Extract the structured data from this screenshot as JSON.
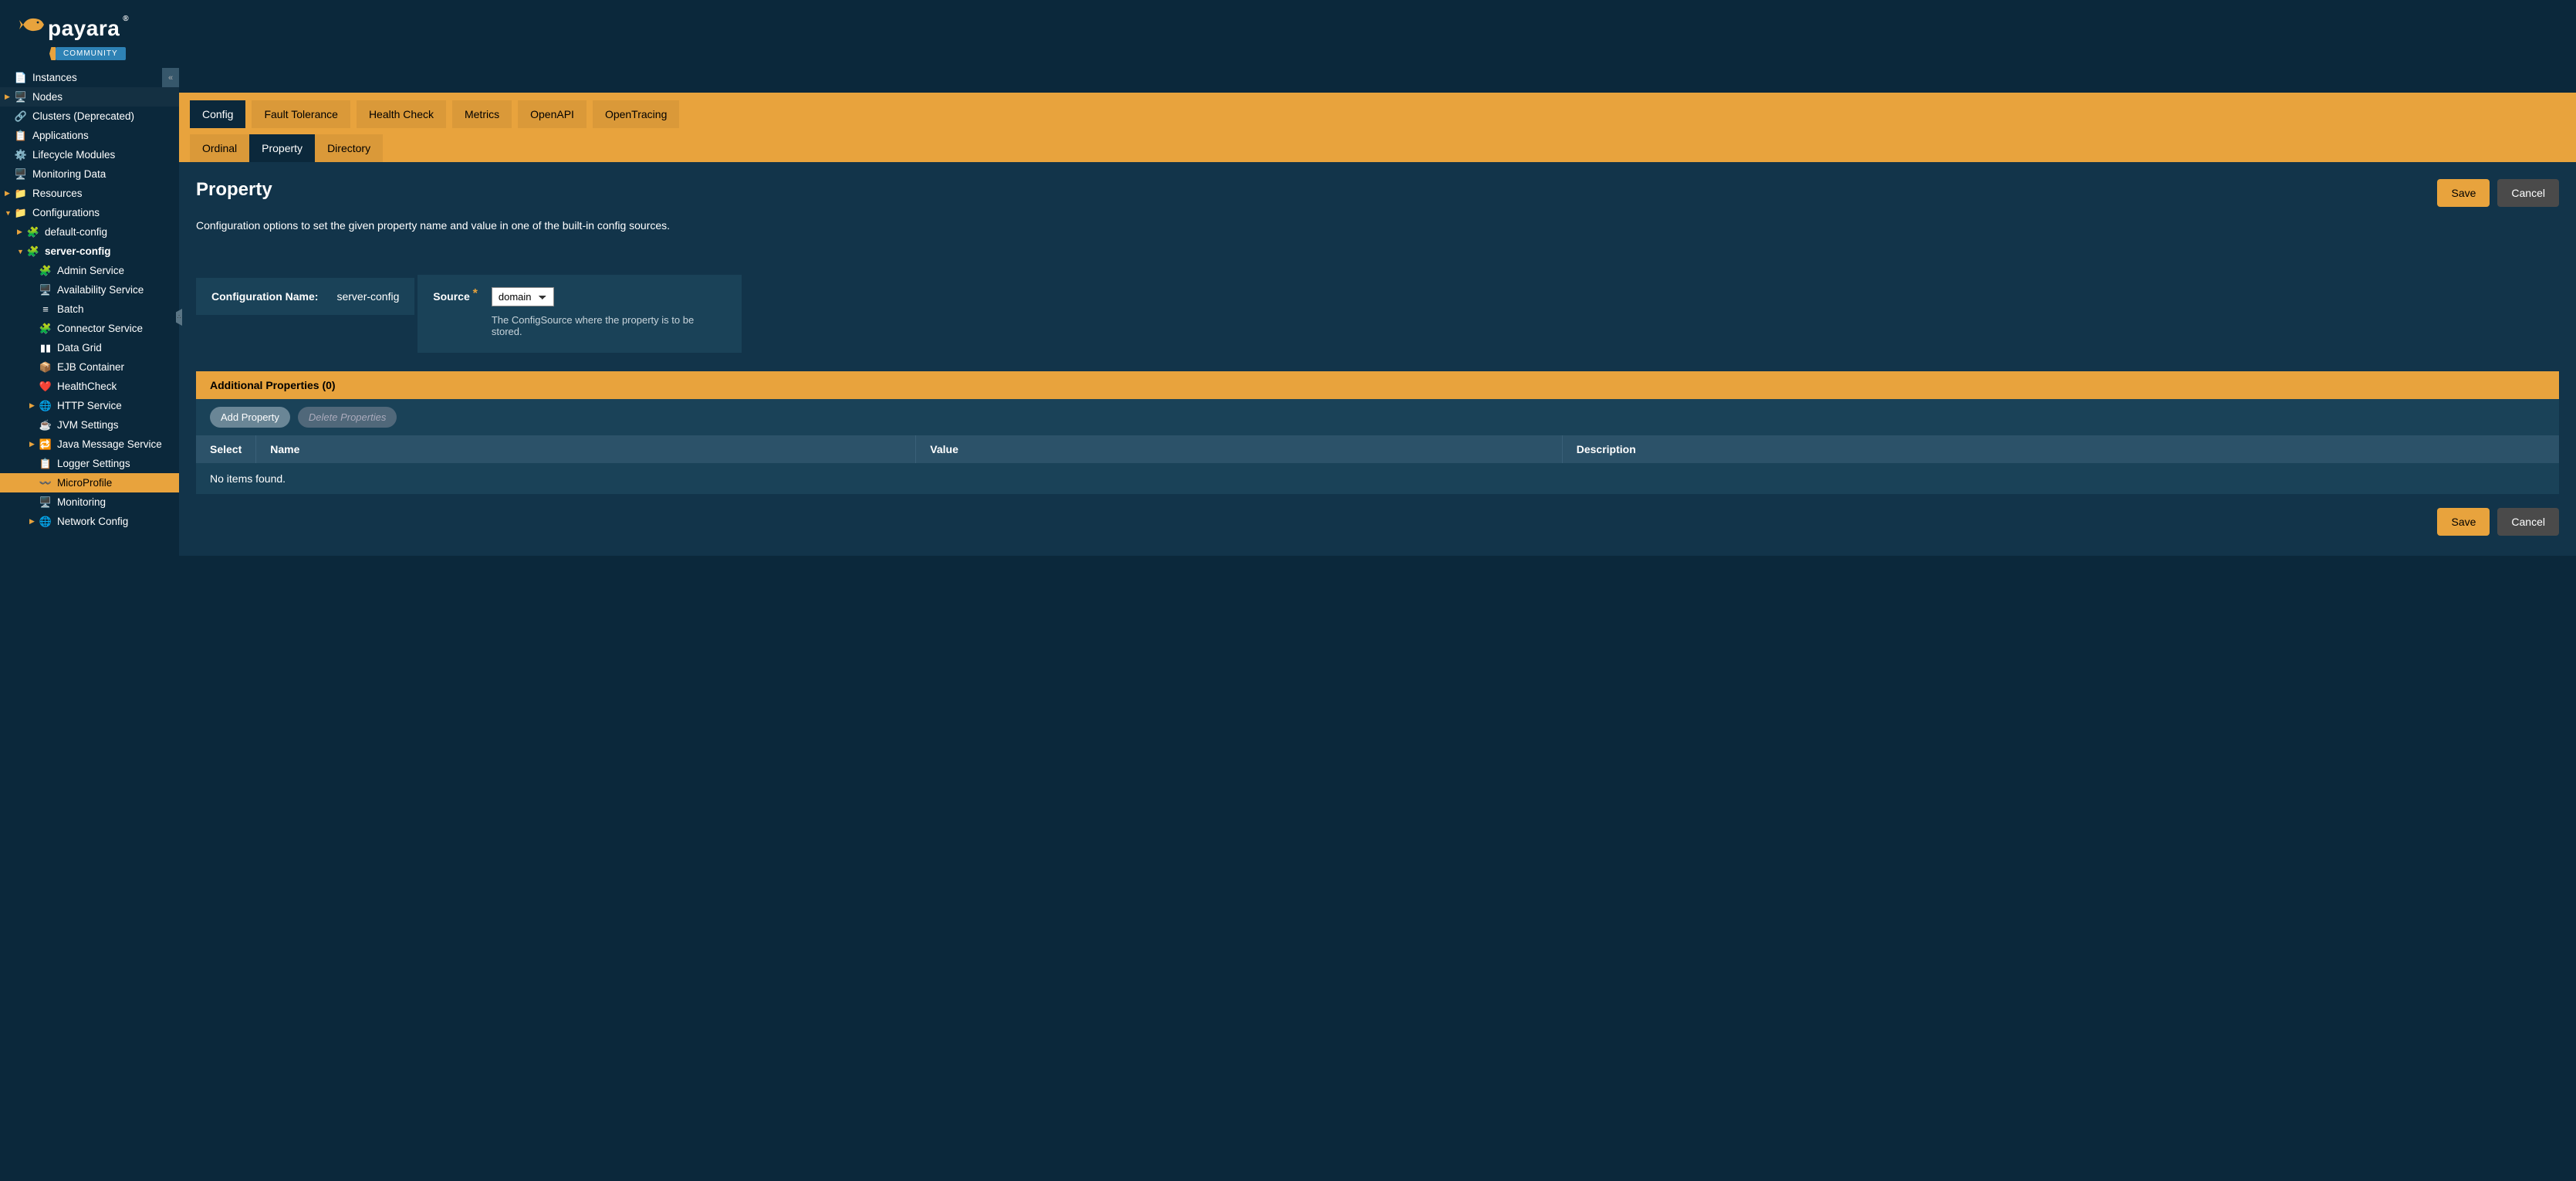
{
  "brand": {
    "name": "payara",
    "badge": "COMMUNITY",
    "registered": "®"
  },
  "sidebar": {
    "collapse_glyph": "«",
    "items": [
      {
        "label": "Instances",
        "depth": 0,
        "arrow": "none",
        "icon": "📄",
        "name": "nav-instances",
        "has_collapse_btn": true
      },
      {
        "label": "Nodes",
        "depth": 0,
        "arrow": "right",
        "icon": "🖥️",
        "name": "nav-nodes",
        "hover": true
      },
      {
        "label": "Clusters (Deprecated)",
        "depth": 0,
        "arrow": "none",
        "icon": "🔗",
        "name": "nav-clusters"
      },
      {
        "label": "Applications",
        "depth": 0,
        "arrow": "none",
        "icon": "📋",
        "name": "nav-applications"
      },
      {
        "label": "Lifecycle Modules",
        "depth": 0,
        "arrow": "none",
        "icon": "⚙️",
        "name": "nav-lifecycle"
      },
      {
        "label": "Monitoring Data",
        "depth": 0,
        "arrow": "none",
        "icon": "🖥️",
        "name": "nav-monitoring-data"
      },
      {
        "label": "Resources",
        "depth": 0,
        "arrow": "right",
        "icon": "📁",
        "name": "nav-resources"
      },
      {
        "label": "Configurations",
        "depth": 0,
        "arrow": "down",
        "icon": "📁",
        "name": "nav-configurations"
      },
      {
        "label": "default-config",
        "depth": 1,
        "arrow": "right",
        "icon": "🧩",
        "name": "nav-default-config"
      },
      {
        "label": "server-config",
        "depth": 1,
        "arrow": "down",
        "icon": "🧩",
        "name": "nav-server-config",
        "bold": true
      },
      {
        "label": "Admin Service",
        "depth": 2,
        "arrow": "none",
        "icon": "🧩",
        "name": "nav-admin-service",
        "icon_color": "#e8a33d"
      },
      {
        "label": "Availability Service",
        "depth": 2,
        "arrow": "none",
        "icon": "🖥️",
        "name": "nav-availability"
      },
      {
        "label": "Batch",
        "depth": 2,
        "arrow": "none",
        "icon": "≡",
        "name": "nav-batch"
      },
      {
        "label": "Connector Service",
        "depth": 2,
        "arrow": "none",
        "icon": "🧩",
        "name": "nav-connector",
        "icon_color": "#e8a33d"
      },
      {
        "label": "Data Grid",
        "depth": 2,
        "arrow": "none",
        "icon": "▮▮",
        "name": "nav-data-grid"
      },
      {
        "label": "EJB Container",
        "depth": 2,
        "arrow": "none",
        "icon": "📦",
        "name": "nav-ejb"
      },
      {
        "label": "HealthCheck",
        "depth": 2,
        "arrow": "none",
        "icon": "❤️",
        "name": "nav-healthcheck",
        "icon_color": "#e8a33d"
      },
      {
        "label": "HTTP Service",
        "depth": 2,
        "arrow": "right",
        "icon": "🌐",
        "name": "nav-http"
      },
      {
        "label": "JVM Settings",
        "depth": 2,
        "arrow": "none",
        "icon": "☕",
        "name": "nav-jvm"
      },
      {
        "label": "Java Message Service",
        "depth": 2,
        "arrow": "right",
        "icon": "🔁",
        "name": "nav-jms",
        "icon_color": "#e8a33d"
      },
      {
        "label": "Logger Settings",
        "depth": 2,
        "arrow": "none",
        "icon": "📋",
        "name": "nav-logger"
      },
      {
        "label": "MicroProfile",
        "depth": 2,
        "arrow": "none",
        "icon": "〰️",
        "name": "nav-microprofile",
        "sel": true
      },
      {
        "label": "Monitoring",
        "depth": 2,
        "arrow": "none",
        "icon": "🖥️",
        "name": "nav-monitoring"
      },
      {
        "label": "Network Config",
        "depth": 2,
        "arrow": "right",
        "icon": "🌐",
        "name": "nav-network"
      }
    ]
  },
  "tabs_primary": [
    {
      "label": "Config",
      "active": true,
      "name": "tab-config"
    },
    {
      "label": "Fault Tolerance",
      "active": false,
      "name": "tab-fault-tolerance"
    },
    {
      "label": "Health Check",
      "active": false,
      "name": "tab-health-check"
    },
    {
      "label": "Metrics",
      "active": false,
      "name": "tab-metrics"
    },
    {
      "label": "OpenAPI",
      "active": false,
      "name": "tab-openapi"
    },
    {
      "label": "OpenTracing",
      "active": false,
      "name": "tab-opentracing"
    }
  ],
  "tabs_secondary": [
    {
      "label": "Ordinal",
      "active": false,
      "name": "subtab-ordinal"
    },
    {
      "label": "Property",
      "active": true,
      "name": "subtab-property"
    },
    {
      "label": "Directory",
      "active": false,
      "name": "subtab-directory"
    }
  ],
  "page": {
    "title": "Property",
    "description": "Configuration options to set the given property name and value in one of the built-in config sources.",
    "save_label": "Save",
    "cancel_label": "Cancel",
    "config_name_label": "Configuration Name:",
    "config_name_value": "server-config",
    "source_label": "Source",
    "source_value": "domain",
    "source_help": "The ConfigSource where the property is to be stored."
  },
  "table": {
    "title": "Additional Properties (0)",
    "btn_add": "Add Property",
    "btn_delete": "Delete Properties",
    "columns": [
      "Select",
      "Name",
      "Value",
      "Description"
    ],
    "empty": "No items found."
  },
  "footer": {
    "save_label": "Save",
    "cancel_label": "Cancel"
  },
  "colors": {
    "accent": "#e8a33d"
  }
}
